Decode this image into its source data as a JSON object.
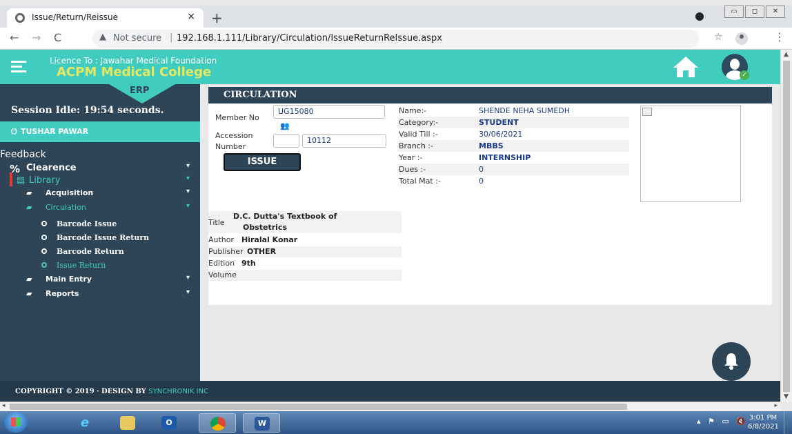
{
  "browser": {
    "tab_title": "Issue/Return/Reissue",
    "tab_close": "×",
    "new_tab": "+",
    "security_label": "Not secure",
    "url": "192.168.1.111/Library/Circulation/IssueReturnReIssue.aspx"
  },
  "header": {
    "licence": "Licence To : Jawahar Medical Foundation",
    "college": "ACPM Medical College",
    "accent_color": "#41ccc0"
  },
  "sidebar": {
    "erp_label": "ERP",
    "session": "Session Idle: 19:54 seconds.",
    "user": "TUSHAR PAWAR",
    "feedback": "Feedback",
    "items": [
      {
        "label": "Clearence"
      },
      {
        "label": "Library"
      },
      {
        "label": "Acquisition"
      },
      {
        "label": "Circulation"
      },
      {
        "label": "Barcode Issue"
      },
      {
        "label": "Barcode Issue Return"
      },
      {
        "label": "Barcode Return"
      },
      {
        "label": "Issue Return"
      },
      {
        "label": "Main Entry"
      },
      {
        "label": "Reports"
      }
    ]
  },
  "circulation": {
    "title": "CIRCULATION",
    "member_label": "Member No",
    "member_value": "UG15080",
    "accession_label_1": "Accession",
    "accession_label_2": "Number",
    "accession_value": "10112",
    "issue_button": "ISSUE",
    "info": [
      {
        "key": "Name:-",
        "value": "SHENDE NEHA SUMEDH"
      },
      {
        "key": "Category:-",
        "value": "STUDENT"
      },
      {
        "key": "Valid Till :-",
        "value": "30/06/2021"
      },
      {
        "key": "Branch :-",
        "value": "MBBS"
      },
      {
        "key": "Year :-",
        "value": "INTERNSHIP"
      },
      {
        "key": "Dues :-",
        "value": "0"
      },
      {
        "key": "Total Mat :-",
        "value": "0"
      }
    ],
    "book": {
      "title_label": "Title",
      "title_value_1": "D.C. Dutta's Textbook of",
      "title_value_2": "Obstetrics",
      "author_label": "Author",
      "author_value": "Hiralal Konar",
      "publisher_label": "Publisher",
      "publisher_value": "OTHER",
      "edition_label": "Edition",
      "edition_value": "9th",
      "volume_label": "Volume"
    }
  },
  "footer": {
    "copyright": "COPYRIGHT © 2019 · DESIGN BY",
    "designer": "SYNCHRONIK INC"
  },
  "taskbar": {
    "time": "3:01 PM",
    "date": "6/8/2021"
  }
}
